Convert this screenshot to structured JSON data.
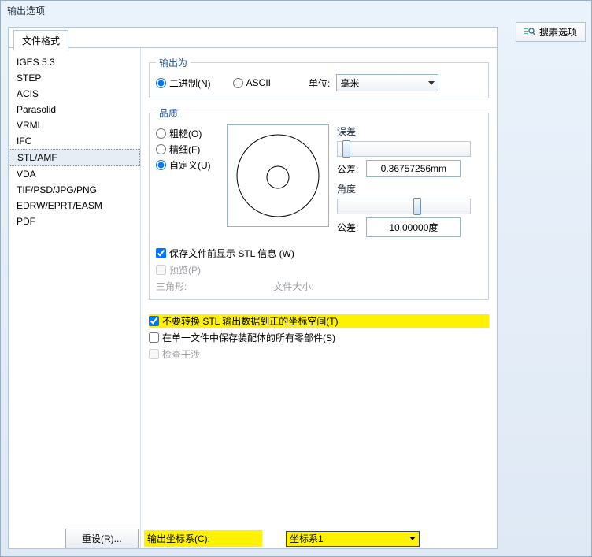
{
  "window": {
    "title": "输出选项"
  },
  "toolbar": {
    "search": "搜素选项"
  },
  "tab": {
    "label": "文件格式"
  },
  "formats": [
    "IGES 5.3",
    "STEP",
    "ACIS",
    "Parasolid",
    "VRML",
    "IFC",
    "STL/AMF",
    "VDA",
    "TIF/PSD/JPG/PNG",
    "EDRW/EPRT/EASM",
    "PDF"
  ],
  "selected_format_index": 6,
  "output_as": {
    "legend": "输出为",
    "binary": "二进制(N)",
    "ascii": "ASCII",
    "selected": "binary",
    "unit_label": "单位:",
    "unit_value": "毫米"
  },
  "quality": {
    "legend": "品质",
    "coarse": "粗糙(O)",
    "fine": "精细(F)",
    "custom": "自定义(U)",
    "selected": "custom",
    "deviation_label": "误差",
    "tolerance_label": "公差:",
    "tolerance_value": "0.36757256mm",
    "angle_label": "角度",
    "angle_tol_value": "10.00000度",
    "show_stl": "保存文件前显示 STL 信息 (W)",
    "show_stl_checked": true,
    "preview": "预览(P)",
    "triangles": "三角形:",
    "filesize": "文件大小:"
  },
  "options": {
    "no_transform": "不要转换 STL 输出数据到正的坐标空间(T)",
    "no_transform_checked": true,
    "single_file": "在单一文件中保存装配体的所有零部件(S)",
    "single_file_checked": false,
    "check_interference": "检查干涉",
    "check_interference_enabled": false
  },
  "coord": {
    "label": "输出坐标系(C):",
    "value": "坐标系1"
  },
  "buttons": {
    "reset": "重设(R)..."
  }
}
